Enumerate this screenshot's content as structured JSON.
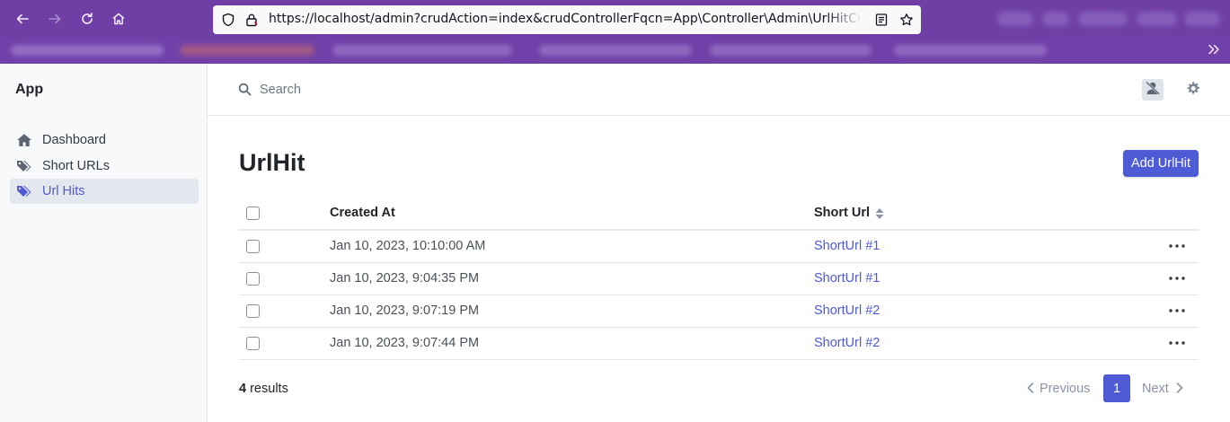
{
  "browser": {
    "url": "https://localhost/admin?crudAction=index&crudControllerFqcn=App\\Controller\\Admin\\UrlHitCrudController",
    "icons": [
      "back-arrow-icon",
      "forward-arrow-icon",
      "reload-icon",
      "home-icon",
      "shield-icon",
      "lock-icon",
      "reader-view-icon",
      "star-icon",
      "chevron-double-right-icon"
    ],
    "accent": "#6f3fa6"
  },
  "sidebar": {
    "brand": "App",
    "items": [
      {
        "label": "Dashboard",
        "icon": "home-icon",
        "active": false
      },
      {
        "label": "Short URLs",
        "icon": "tags-icon",
        "active": false
      },
      {
        "label": "Url Hits",
        "icon": "tags-icon",
        "active": true
      }
    ]
  },
  "topbar": {
    "search_placeholder": "Search",
    "icons": [
      "search-icon",
      "user-slash-icon",
      "gear-icon"
    ]
  },
  "main": {
    "title": "UrlHit",
    "add_button": "Add UrlHit",
    "columns": [
      "Created At",
      "Short Url"
    ],
    "rows": [
      {
        "created_at": "Jan 10, 2023, 10:10:00 AM",
        "short_url": "ShortUrl #1"
      },
      {
        "created_at": "Jan 10, 2023, 9:04:35 PM",
        "short_url": "ShortUrl #1"
      },
      {
        "created_at": "Jan 10, 2023, 9:07:19 PM",
        "short_url": "ShortUrl #2"
      },
      {
        "created_at": "Jan 10, 2023, 9:07:44 PM",
        "short_url": "ShortUrl #2"
      }
    ],
    "results_count": "4",
    "results_label": " results",
    "pagination": {
      "previous": "Previous",
      "current_page": "1",
      "next": "Next"
    }
  },
  "colors": {
    "primary": "#4e5bd4",
    "sidebar_bg": "#f8f9fa",
    "active_item_bg": "#e3e7ee"
  }
}
